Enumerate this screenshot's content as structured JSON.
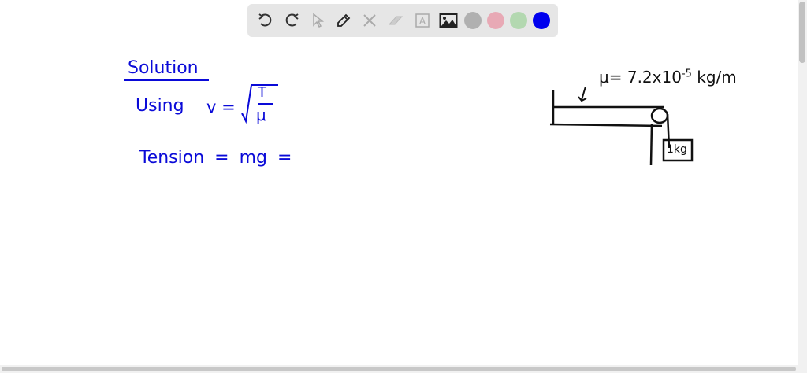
{
  "toolbar": {
    "tools": [
      "undo-icon",
      "redo-icon",
      "select-icon",
      "pen-icon",
      "tools-icon",
      "eraser-icon",
      "text-icon",
      "image-icon"
    ],
    "colors": [
      "#b0b0b0",
      "#e8a9b5",
      "#b3d8b0",
      "#0000ee"
    ]
  },
  "canvas": {
    "heading": "Solution",
    "line1_prefix": "Using",
    "line1_formula": "v =",
    "formula_num": "T",
    "formula_den": "μ",
    "line2": "Tension =  mg  =",
    "diagram_mu": "μ= 7.2x10",
    "diagram_exp": "-5",
    "diagram_unit": "kg/m",
    "mass_label": "1kg"
  },
  "accent": "#0a0ad8"
}
